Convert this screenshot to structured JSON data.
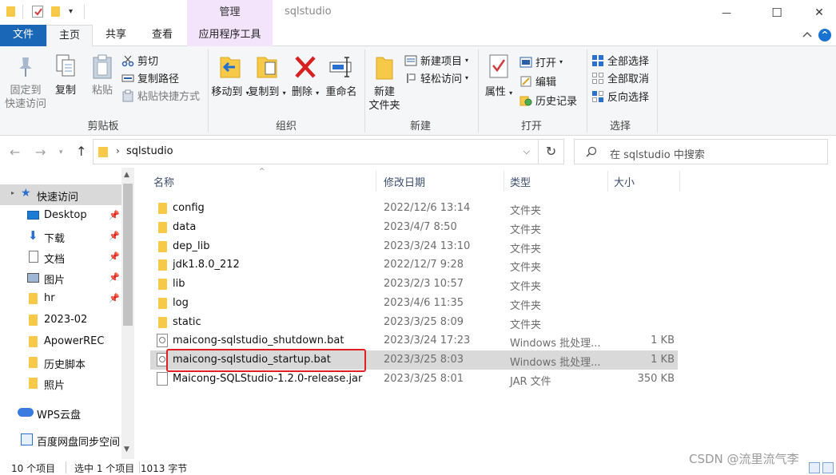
{
  "window": {
    "title": "sqlstudio",
    "context_tab": "管理",
    "controls": {
      "minimize": "—",
      "maximize": "☐",
      "close": "✕"
    }
  },
  "quick_access": {
    "dropdown": "▾"
  },
  "tabs": [
    {
      "label": "文件"
    },
    {
      "label": "主页"
    },
    {
      "label": "共享"
    },
    {
      "label": "查看"
    },
    {
      "label": "应用程序工具"
    }
  ],
  "ribbon": {
    "clipboard": {
      "label": "剪贴板",
      "pin": "固定到\n快速访问",
      "copy": "复制",
      "paste": "粘贴",
      "cut": "剪切",
      "copy_path": "复制路径",
      "paste_shortcut": "粘贴快捷方式"
    },
    "organize": {
      "label": "组织",
      "move_to": "移动到",
      "copy_to": "复制到",
      "delete": "删除",
      "rename": "重命名"
    },
    "new": {
      "label": "新建",
      "new_folder": "新建\n文件夹",
      "new_item": "新建项目",
      "easy_access": "轻松访问"
    },
    "open": {
      "label": "打开",
      "properties": "属性",
      "open": "打开",
      "edit": "编辑",
      "history": "历史记录"
    },
    "select": {
      "label": "选择",
      "select_all": "全部选择",
      "select_none": "全部取消",
      "invert": "反向选择"
    }
  },
  "address": {
    "path": "sqlstudio",
    "separator": "›",
    "back": "←",
    "forward": "→",
    "up": "↑",
    "refresh": "↻",
    "search_placeholder": "在 sqlstudio 中搜索"
  },
  "sidebar": {
    "items": [
      {
        "label": "快速访问"
      },
      {
        "label": "Desktop"
      },
      {
        "label": "下载"
      },
      {
        "label": "文档"
      },
      {
        "label": "图片"
      },
      {
        "label": "hr"
      },
      {
        "label": "2023-02"
      },
      {
        "label": "ApowerREC"
      },
      {
        "label": "历史脚本"
      },
      {
        "label": "照片"
      },
      {
        "label": "WPS云盘"
      },
      {
        "label": "百度网盘同步空间"
      }
    ]
  },
  "columns": {
    "name": "名称",
    "date": "修改日期",
    "type": "类型",
    "size": "大小"
  },
  "files": [
    {
      "name": "config",
      "date": "2022/12/6 13:14",
      "type": "文件夹",
      "size": "",
      "kind": "folder"
    },
    {
      "name": "data",
      "date": "2023/4/7 8:50",
      "type": "文件夹",
      "size": "",
      "kind": "folder"
    },
    {
      "name": "dep_lib",
      "date": "2023/3/24 13:10",
      "type": "文件夹",
      "size": "",
      "kind": "folder"
    },
    {
      "name": "jdk1.8.0_212",
      "date": "2022/12/7 9:28",
      "type": "文件夹",
      "size": "",
      "kind": "folder"
    },
    {
      "name": "lib",
      "date": "2023/2/3 10:57",
      "type": "文件夹",
      "size": "",
      "kind": "folder"
    },
    {
      "name": "log",
      "date": "2023/4/6 11:35",
      "type": "文件夹",
      "size": "",
      "kind": "folder"
    },
    {
      "name": "static",
      "date": "2023/3/25 8:09",
      "type": "文件夹",
      "size": "",
      "kind": "folder"
    },
    {
      "name": "maicong-sqlstudio_shutdown.bat",
      "date": "2023/3/24 17:23",
      "type": "Windows 批处理...",
      "size": "1 KB",
      "kind": "bat"
    },
    {
      "name": "maicong-sqlstudio_startup.bat",
      "date": "2023/3/25 8:03",
      "type": "Windows 批处理...",
      "size": "1 KB",
      "kind": "bat"
    },
    {
      "name": "Maicong-SQLStudio-1.2.0-release.jar",
      "date": "2023/3/25 8:01",
      "type": "JAR 文件",
      "size": "350 KB",
      "kind": "jar"
    }
  ],
  "selected_file": "maicong-sqlstudio_startup.bat",
  "status": {
    "count": "10 个项目",
    "selection": "选中 1 个项目  1013 字节"
  },
  "watermark": "CSDN @流里流气李",
  "colors": {
    "file_tab": "#1a66b7",
    "context_tab": "#f3e3fb",
    "folder": "#f7c948",
    "selection": "#d9d9d9",
    "highlight_border": "#e02020"
  }
}
